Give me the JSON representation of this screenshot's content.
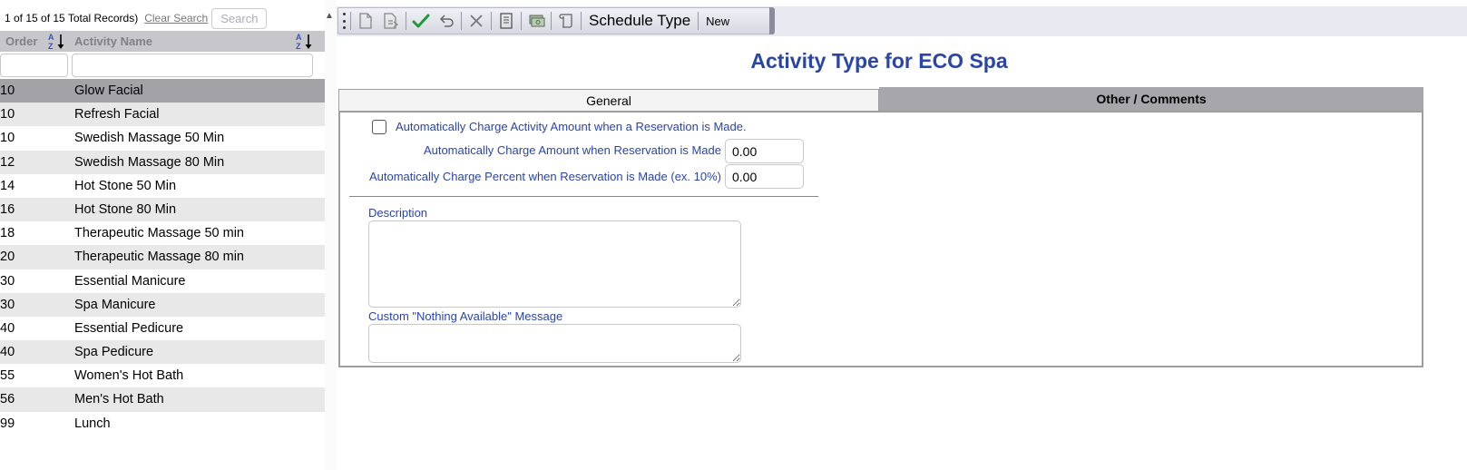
{
  "records": {
    "count_text": "1 of 15 of 15 Total Records)",
    "clear_search_label": "Clear Search",
    "search_placeholder": "Search"
  },
  "grid": {
    "headers": {
      "order": "Order",
      "activity_name": "Activity Name"
    },
    "rows": [
      {
        "order": "10",
        "name": "Glow Facial"
      },
      {
        "order": "10",
        "name": "Refresh Facial"
      },
      {
        "order": "10",
        "name": "Swedish Massage 50 Min"
      },
      {
        "order": "12",
        "name": "Swedish Massage 80 Min"
      },
      {
        "order": "14",
        "name": "Hot Stone 50 Min"
      },
      {
        "order": "16",
        "name": "Hot Stone 80 Min"
      },
      {
        "order": "18",
        "name": "Therapeutic Massage 50 min"
      },
      {
        "order": "20",
        "name": "Therapeutic Massage 80 min"
      },
      {
        "order": "30",
        "name": "Essential Manicure"
      },
      {
        "order": "30",
        "name": "Spa Manicure"
      },
      {
        "order": "40",
        "name": "Essential Pedicure"
      },
      {
        "order": "40",
        "name": "Spa Pedicure"
      },
      {
        "order": "55",
        "name": "Women's Hot Bath"
      },
      {
        "order": "56",
        "name": "Men's Hot Bath"
      },
      {
        "order": "99",
        "name": "Lunch"
      }
    ],
    "selected_index": 0
  },
  "toolbar": {
    "icons": [
      "new-document-icon",
      "copy-document-icon",
      "save-check-icon",
      "undo-icon",
      "delete-x-icon",
      "report-icon",
      "money-icon",
      "scroll-icon"
    ],
    "schedule_type_label": "Schedule Type",
    "new_label": "New"
  },
  "page": {
    "title": "Activity Type for ECO Spa"
  },
  "tabs": {
    "general": "General",
    "other_comments": "Other / Comments",
    "active": "other_comments"
  },
  "form": {
    "auto_charge_checkbox_label": "Automatically Charge Activity Amount when a Reservation is Made.",
    "auto_charge_checked": false,
    "auto_amount_label": "Automatically Charge Amount when Reservation is Made",
    "auto_amount_value": "0.00",
    "auto_percent_label": "Automatically Charge Percent when Reservation is Made (ex. 10%)",
    "auto_percent_value": "0.00",
    "description_label": "Description",
    "description_value": "",
    "nothing_available_label": "Custom \"Nothing Available\" Message",
    "nothing_available_value": ""
  },
  "colors": {
    "accent_blue": "#2a45a8",
    "selected_row": "#a3a2a7",
    "alt_row": "#e8e8e8",
    "header_bg": "#c7c7cb",
    "check_green": "#1f9a3a"
  }
}
